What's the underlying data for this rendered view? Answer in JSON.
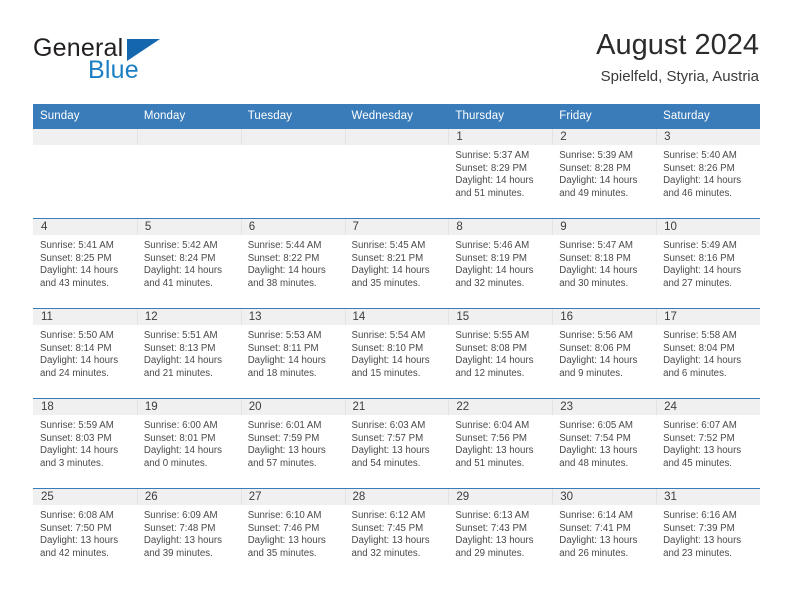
{
  "logo": {
    "word_one": "General",
    "word_two": "Blue",
    "triangle_icon": "triangle-icon"
  },
  "header": {
    "title": "August 2024",
    "subtitle": "Spielfeld, Styria, Austria"
  },
  "colors": {
    "header_blue": "#3a7cb9",
    "logo_blue": "#1c7fc4",
    "date_strip_grey": "#f0f0f0",
    "text": "#2b2b2b"
  },
  "weekday_headers": [
    "Sunday",
    "Monday",
    "Tuesday",
    "Wednesday",
    "Thursday",
    "Friday",
    "Saturday"
  ],
  "labels": {
    "sunrise_prefix": "Sunrise:",
    "sunset_prefix": "Sunset:",
    "daylight_prefix": "Daylight:"
  },
  "weeks": [
    [
      {
        "date": "",
        "line1": "",
        "line2": "",
        "line3": "",
        "line4": ""
      },
      {
        "date": "",
        "line1": "",
        "line2": "",
        "line3": "",
        "line4": ""
      },
      {
        "date": "",
        "line1": "",
        "line2": "",
        "line3": "",
        "line4": ""
      },
      {
        "date": "",
        "line1": "",
        "line2": "",
        "line3": "",
        "line4": ""
      },
      {
        "date": "1",
        "line1": "Sunrise: 5:37 AM",
        "line2": "Sunset: 8:29 PM",
        "line3": "Daylight: 14 hours",
        "line4": "and 51 minutes."
      },
      {
        "date": "2",
        "line1": "Sunrise: 5:39 AM",
        "line2": "Sunset: 8:28 PM",
        "line3": "Daylight: 14 hours",
        "line4": "and 49 minutes."
      },
      {
        "date": "3",
        "line1": "Sunrise: 5:40 AM",
        "line2": "Sunset: 8:26 PM",
        "line3": "Daylight: 14 hours",
        "line4": "and 46 minutes."
      }
    ],
    [
      {
        "date": "4",
        "line1": "Sunrise: 5:41 AM",
        "line2": "Sunset: 8:25 PM",
        "line3": "Daylight: 14 hours",
        "line4": "and 43 minutes."
      },
      {
        "date": "5",
        "line1": "Sunrise: 5:42 AM",
        "line2": "Sunset: 8:24 PM",
        "line3": "Daylight: 14 hours",
        "line4": "and 41 minutes."
      },
      {
        "date": "6",
        "line1": "Sunrise: 5:44 AM",
        "line2": "Sunset: 8:22 PM",
        "line3": "Daylight: 14 hours",
        "line4": "and 38 minutes."
      },
      {
        "date": "7",
        "line1": "Sunrise: 5:45 AM",
        "line2": "Sunset: 8:21 PM",
        "line3": "Daylight: 14 hours",
        "line4": "and 35 minutes."
      },
      {
        "date": "8",
        "line1": "Sunrise: 5:46 AM",
        "line2": "Sunset: 8:19 PM",
        "line3": "Daylight: 14 hours",
        "line4": "and 32 minutes."
      },
      {
        "date": "9",
        "line1": "Sunrise: 5:47 AM",
        "line2": "Sunset: 8:18 PM",
        "line3": "Daylight: 14 hours",
        "line4": "and 30 minutes."
      },
      {
        "date": "10",
        "line1": "Sunrise: 5:49 AM",
        "line2": "Sunset: 8:16 PM",
        "line3": "Daylight: 14 hours",
        "line4": "and 27 minutes."
      }
    ],
    [
      {
        "date": "11",
        "line1": "Sunrise: 5:50 AM",
        "line2": "Sunset: 8:14 PM",
        "line3": "Daylight: 14 hours",
        "line4": "and 24 minutes."
      },
      {
        "date": "12",
        "line1": "Sunrise: 5:51 AM",
        "line2": "Sunset: 8:13 PM",
        "line3": "Daylight: 14 hours",
        "line4": "and 21 minutes."
      },
      {
        "date": "13",
        "line1": "Sunrise: 5:53 AM",
        "line2": "Sunset: 8:11 PM",
        "line3": "Daylight: 14 hours",
        "line4": "and 18 minutes."
      },
      {
        "date": "14",
        "line1": "Sunrise: 5:54 AM",
        "line2": "Sunset: 8:10 PM",
        "line3": "Daylight: 14 hours",
        "line4": "and 15 minutes."
      },
      {
        "date": "15",
        "line1": "Sunrise: 5:55 AM",
        "line2": "Sunset: 8:08 PM",
        "line3": "Daylight: 14 hours",
        "line4": "and 12 minutes."
      },
      {
        "date": "16",
        "line1": "Sunrise: 5:56 AM",
        "line2": "Sunset: 8:06 PM",
        "line3": "Daylight: 14 hours",
        "line4": "and 9 minutes."
      },
      {
        "date": "17",
        "line1": "Sunrise: 5:58 AM",
        "line2": "Sunset: 8:04 PM",
        "line3": "Daylight: 14 hours",
        "line4": "and 6 minutes."
      }
    ],
    [
      {
        "date": "18",
        "line1": "Sunrise: 5:59 AM",
        "line2": "Sunset: 8:03 PM",
        "line3": "Daylight: 14 hours",
        "line4": "and 3 minutes."
      },
      {
        "date": "19",
        "line1": "Sunrise: 6:00 AM",
        "line2": "Sunset: 8:01 PM",
        "line3": "Daylight: 14 hours",
        "line4": "and 0 minutes."
      },
      {
        "date": "20",
        "line1": "Sunrise: 6:01 AM",
        "line2": "Sunset: 7:59 PM",
        "line3": "Daylight: 13 hours",
        "line4": "and 57 minutes."
      },
      {
        "date": "21",
        "line1": "Sunrise: 6:03 AM",
        "line2": "Sunset: 7:57 PM",
        "line3": "Daylight: 13 hours",
        "line4": "and 54 minutes."
      },
      {
        "date": "22",
        "line1": "Sunrise: 6:04 AM",
        "line2": "Sunset: 7:56 PM",
        "line3": "Daylight: 13 hours",
        "line4": "and 51 minutes."
      },
      {
        "date": "23",
        "line1": "Sunrise: 6:05 AM",
        "line2": "Sunset: 7:54 PM",
        "line3": "Daylight: 13 hours",
        "line4": "and 48 minutes."
      },
      {
        "date": "24",
        "line1": "Sunrise: 6:07 AM",
        "line2": "Sunset: 7:52 PM",
        "line3": "Daylight: 13 hours",
        "line4": "and 45 minutes."
      }
    ],
    [
      {
        "date": "25",
        "line1": "Sunrise: 6:08 AM",
        "line2": "Sunset: 7:50 PM",
        "line3": "Daylight: 13 hours",
        "line4": "and 42 minutes."
      },
      {
        "date": "26",
        "line1": "Sunrise: 6:09 AM",
        "line2": "Sunset: 7:48 PM",
        "line3": "Daylight: 13 hours",
        "line4": "and 39 minutes."
      },
      {
        "date": "27",
        "line1": "Sunrise: 6:10 AM",
        "line2": "Sunset: 7:46 PM",
        "line3": "Daylight: 13 hours",
        "line4": "and 35 minutes."
      },
      {
        "date": "28",
        "line1": "Sunrise: 6:12 AM",
        "line2": "Sunset: 7:45 PM",
        "line3": "Daylight: 13 hours",
        "line4": "and 32 minutes."
      },
      {
        "date": "29",
        "line1": "Sunrise: 6:13 AM",
        "line2": "Sunset: 7:43 PM",
        "line3": "Daylight: 13 hours",
        "line4": "and 29 minutes."
      },
      {
        "date": "30",
        "line1": "Sunrise: 6:14 AM",
        "line2": "Sunset: 7:41 PM",
        "line3": "Daylight: 13 hours",
        "line4": "and 26 minutes."
      },
      {
        "date": "31",
        "line1": "Sunrise: 6:16 AM",
        "line2": "Sunset: 7:39 PM",
        "line3": "Daylight: 13 hours",
        "line4": "and 23 minutes."
      }
    ]
  ]
}
